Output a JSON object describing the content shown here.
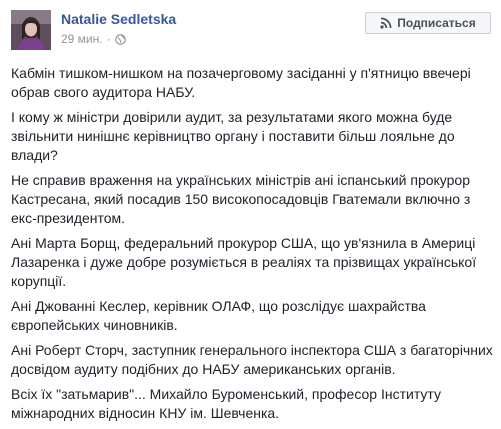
{
  "post": {
    "author": "Natalie Sedletska",
    "time": "29 мин.",
    "separator": "·",
    "privacy_icon": "globe-icon",
    "follow_button_label": "Подписаться",
    "follow_icon": "rss-icon",
    "paragraphs": [
      "Кабмін тишком-нишком на позачерговому засіданні у п'ятницю ввечері обрав свого аудитора НАБУ.",
      "І кому ж міністри довірили аудит, за результатами якого можна буде звільнити нинішнє керівництво органу і поставити більш лояльне до влади?",
      "Не справив враження на українських міністрів ані іспанський прокурор Кастресана, який посадив 150 високопосадовців Гватемали включно з екс-президентом.",
      "Ані Марта Борщ, федеральний прокурор США, що ув'язнила в Америці Лазаренка і дуже добре розуміється в реаліях та прізвищах української корупції.",
      "Ані Джованні Кеслер, керівник ОЛАФ, що розслідує шахрайства європейських чиновників.",
      "Ані Роберт Сторч, заступник генерального інспектора США з багаторічних досвідом аудиту подібних до НАБУ американських органів.",
      "Всіх їх \"затьмарив\"... Михайло Буроменський, професор Інституту міжнародних відносин КНУ ім. Шевченка."
    ]
  },
  "colors": {
    "author_link": "#365899",
    "meta_text": "#90949c",
    "body_text": "#1d2129",
    "button_bg": "#f6f7f9",
    "button_border": "#ccd0d5"
  }
}
